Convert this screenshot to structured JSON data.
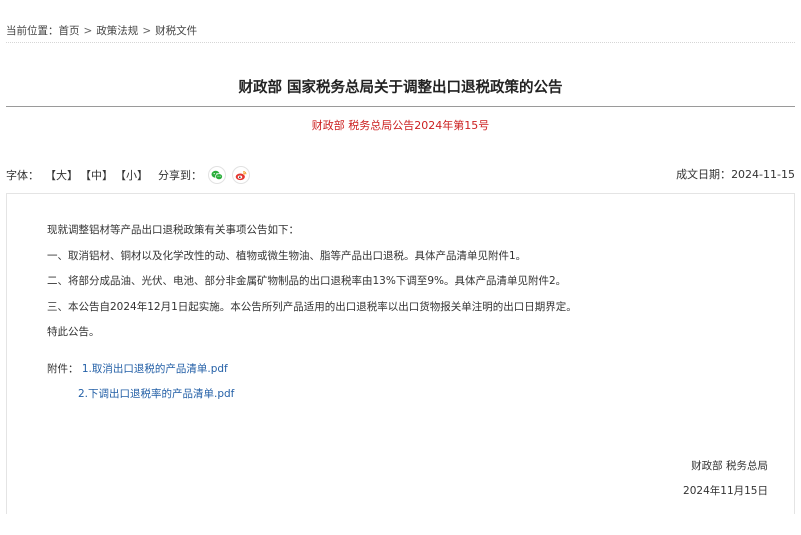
{
  "breadcrumb": {
    "prefix": "当前位置：",
    "items": [
      "首页",
      "政策法规",
      "财税文件"
    ],
    "separator": ">"
  },
  "title": "财政部 国家税务总局关于调整出口退税政策的公告",
  "doc_number": "财政部 税务总局公告2024年第15号",
  "toolbar": {
    "font_label": "字体：",
    "font_sizes": [
      "【大】",
      "【中】",
      "【小】"
    ],
    "share_label": "分享到：",
    "share_icons": [
      "wechat-icon",
      "weibo-icon"
    ],
    "date_label": "成文日期：",
    "date_value": "2024-11-15"
  },
  "body": {
    "paragraphs": [
      "现就调整铝材等产品出口退税政策有关事项公告如下：",
      "一、取消铝材、铜材以及化学改性的动、植物或微生物油、脂等产品出口退税。具体产品清单见附件1。",
      "二、将部分成品油、光伏、电池、部分非金属矿物制品的出口退税率由13%下调至9%。具体产品清单见附件2。",
      "三、本公告自2024年12月1日起实施。本公告所列产品适用的出口退税率以出口货物报关单注明的出口日期界定。",
      "特此公告。"
    ]
  },
  "attachments": {
    "label": "附件：",
    "files": [
      "1.取消出口退税的产品清单.pdf",
      "2.下调出口退税率的产品清单.pdf"
    ]
  },
  "signature": {
    "org": "财政部  税务总局",
    "date": "2024年11月15日"
  },
  "colors": {
    "doc_number": "#cc1f1f",
    "link": "#2460a7",
    "wechat": "#2aae3a",
    "weibo": "#e6352e"
  }
}
